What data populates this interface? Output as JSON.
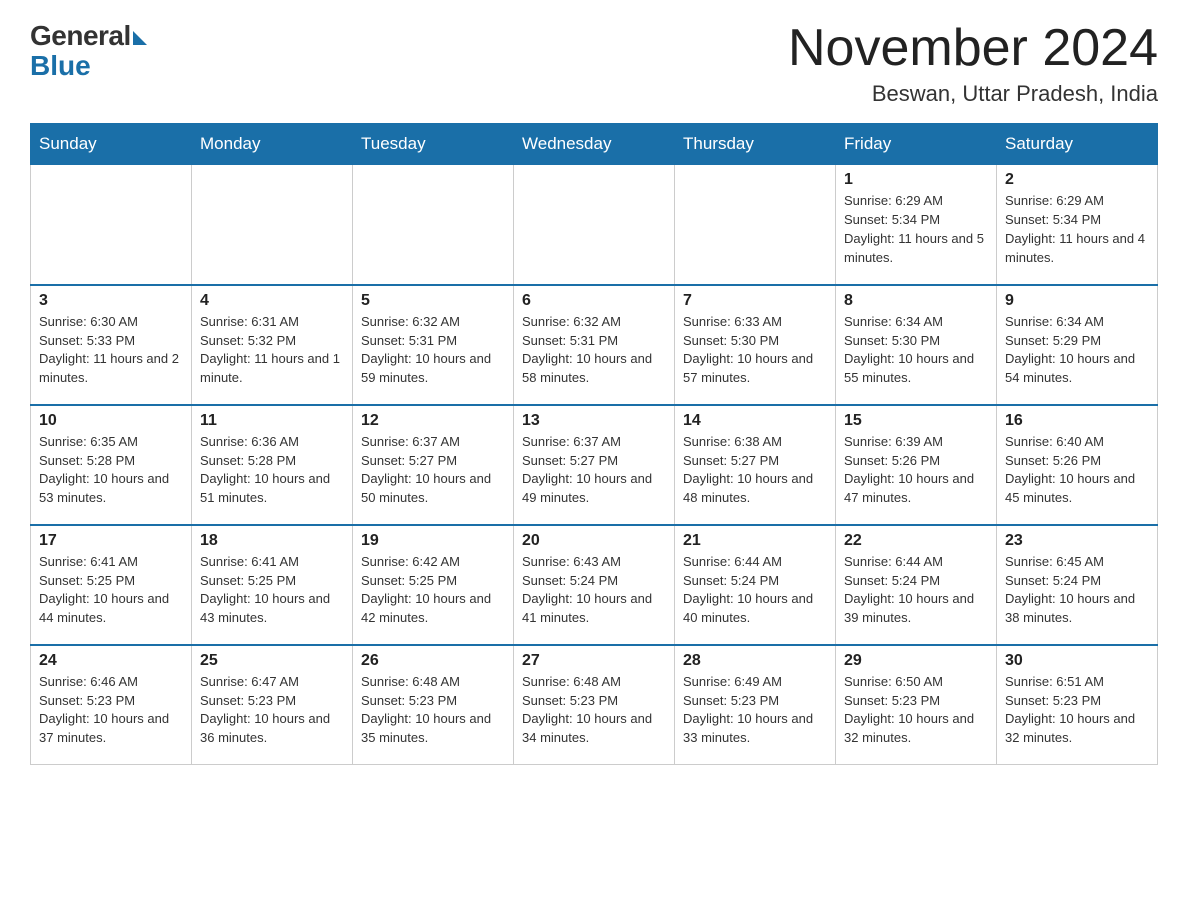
{
  "logo": {
    "general": "General",
    "blue": "Blue"
  },
  "calendar": {
    "title": "November 2024",
    "subtitle": "Beswan, Uttar Pradesh, India"
  },
  "headers": [
    "Sunday",
    "Monday",
    "Tuesday",
    "Wednesday",
    "Thursday",
    "Friday",
    "Saturday"
  ],
  "weeks": [
    [
      {
        "day": "",
        "info": ""
      },
      {
        "day": "",
        "info": ""
      },
      {
        "day": "",
        "info": ""
      },
      {
        "day": "",
        "info": ""
      },
      {
        "day": "",
        "info": ""
      },
      {
        "day": "1",
        "info": "Sunrise: 6:29 AM\nSunset: 5:34 PM\nDaylight: 11 hours and 5 minutes."
      },
      {
        "day": "2",
        "info": "Sunrise: 6:29 AM\nSunset: 5:34 PM\nDaylight: 11 hours and 4 minutes."
      }
    ],
    [
      {
        "day": "3",
        "info": "Sunrise: 6:30 AM\nSunset: 5:33 PM\nDaylight: 11 hours and 2 minutes."
      },
      {
        "day": "4",
        "info": "Sunrise: 6:31 AM\nSunset: 5:32 PM\nDaylight: 11 hours and 1 minute."
      },
      {
        "day": "5",
        "info": "Sunrise: 6:32 AM\nSunset: 5:31 PM\nDaylight: 10 hours and 59 minutes."
      },
      {
        "day": "6",
        "info": "Sunrise: 6:32 AM\nSunset: 5:31 PM\nDaylight: 10 hours and 58 minutes."
      },
      {
        "day": "7",
        "info": "Sunrise: 6:33 AM\nSunset: 5:30 PM\nDaylight: 10 hours and 57 minutes."
      },
      {
        "day": "8",
        "info": "Sunrise: 6:34 AM\nSunset: 5:30 PM\nDaylight: 10 hours and 55 minutes."
      },
      {
        "day": "9",
        "info": "Sunrise: 6:34 AM\nSunset: 5:29 PM\nDaylight: 10 hours and 54 minutes."
      }
    ],
    [
      {
        "day": "10",
        "info": "Sunrise: 6:35 AM\nSunset: 5:28 PM\nDaylight: 10 hours and 53 minutes."
      },
      {
        "day": "11",
        "info": "Sunrise: 6:36 AM\nSunset: 5:28 PM\nDaylight: 10 hours and 51 minutes."
      },
      {
        "day": "12",
        "info": "Sunrise: 6:37 AM\nSunset: 5:27 PM\nDaylight: 10 hours and 50 minutes."
      },
      {
        "day": "13",
        "info": "Sunrise: 6:37 AM\nSunset: 5:27 PM\nDaylight: 10 hours and 49 minutes."
      },
      {
        "day": "14",
        "info": "Sunrise: 6:38 AM\nSunset: 5:27 PM\nDaylight: 10 hours and 48 minutes."
      },
      {
        "day": "15",
        "info": "Sunrise: 6:39 AM\nSunset: 5:26 PM\nDaylight: 10 hours and 47 minutes."
      },
      {
        "day": "16",
        "info": "Sunrise: 6:40 AM\nSunset: 5:26 PM\nDaylight: 10 hours and 45 minutes."
      }
    ],
    [
      {
        "day": "17",
        "info": "Sunrise: 6:41 AM\nSunset: 5:25 PM\nDaylight: 10 hours and 44 minutes."
      },
      {
        "day": "18",
        "info": "Sunrise: 6:41 AM\nSunset: 5:25 PM\nDaylight: 10 hours and 43 minutes."
      },
      {
        "day": "19",
        "info": "Sunrise: 6:42 AM\nSunset: 5:25 PM\nDaylight: 10 hours and 42 minutes."
      },
      {
        "day": "20",
        "info": "Sunrise: 6:43 AM\nSunset: 5:24 PM\nDaylight: 10 hours and 41 minutes."
      },
      {
        "day": "21",
        "info": "Sunrise: 6:44 AM\nSunset: 5:24 PM\nDaylight: 10 hours and 40 minutes."
      },
      {
        "day": "22",
        "info": "Sunrise: 6:44 AM\nSunset: 5:24 PM\nDaylight: 10 hours and 39 minutes."
      },
      {
        "day": "23",
        "info": "Sunrise: 6:45 AM\nSunset: 5:24 PM\nDaylight: 10 hours and 38 minutes."
      }
    ],
    [
      {
        "day": "24",
        "info": "Sunrise: 6:46 AM\nSunset: 5:23 PM\nDaylight: 10 hours and 37 minutes."
      },
      {
        "day": "25",
        "info": "Sunrise: 6:47 AM\nSunset: 5:23 PM\nDaylight: 10 hours and 36 minutes."
      },
      {
        "day": "26",
        "info": "Sunrise: 6:48 AM\nSunset: 5:23 PM\nDaylight: 10 hours and 35 minutes."
      },
      {
        "day": "27",
        "info": "Sunrise: 6:48 AM\nSunset: 5:23 PM\nDaylight: 10 hours and 34 minutes."
      },
      {
        "day": "28",
        "info": "Sunrise: 6:49 AM\nSunset: 5:23 PM\nDaylight: 10 hours and 33 minutes."
      },
      {
        "day": "29",
        "info": "Sunrise: 6:50 AM\nSunset: 5:23 PM\nDaylight: 10 hours and 32 minutes."
      },
      {
        "day": "30",
        "info": "Sunrise: 6:51 AM\nSunset: 5:23 PM\nDaylight: 10 hours and 32 minutes."
      }
    ]
  ]
}
